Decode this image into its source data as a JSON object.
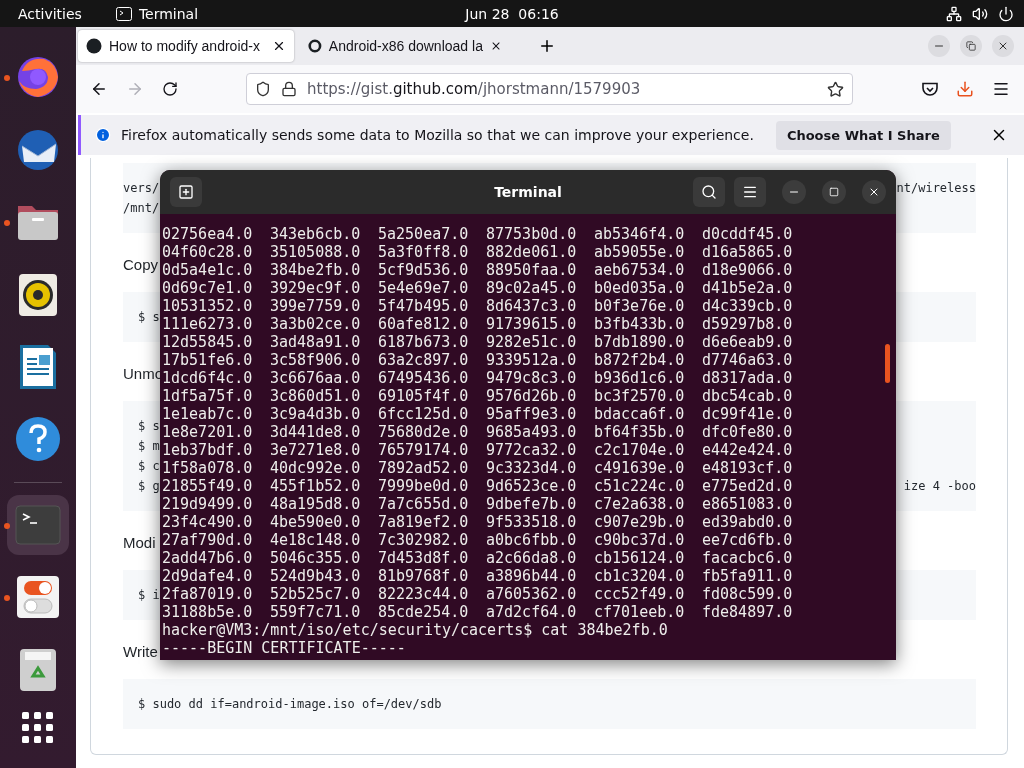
{
  "top_bar": {
    "activities": "Activities",
    "app": "Terminal",
    "clock": "Jun 28  06:16"
  },
  "dock": {
    "favorites": [
      {
        "kind": "browser",
        "running": true,
        "selected": false
      },
      {
        "kind": "mail",
        "running": false,
        "selected": false
      },
      {
        "kind": "files",
        "running": true,
        "selected": false
      },
      {
        "kind": "music",
        "running": false,
        "selected": false
      },
      {
        "kind": "document",
        "running": false,
        "selected": false
      },
      {
        "kind": "help",
        "running": false,
        "selected": false
      }
    ],
    "open": [
      {
        "kind": "terminal",
        "running": true,
        "selected": true
      },
      {
        "kind": "toggles",
        "running": true,
        "selected": false
      },
      {
        "kind": "trash",
        "running": false,
        "selected": false
      }
    ]
  },
  "browser": {
    "tabs": [
      {
        "title": "How to modify android-x",
        "selected": true
      },
      {
        "title": "Android-x86 download la",
        "selected": false
      }
    ],
    "url": {
      "prefix": "https://gist.",
      "host": "github.com",
      "path": "/jhorstmann/1579903"
    },
    "notification": {
      "message": "Firefox automatically sends some data to Mozilla so that we can improve your experience.",
      "button": "Choose What I Share"
    },
    "page": [
      {
        "kind": "code_scrolled",
        "lines": [
          {
            "left": "vers/",
            "right": "nt/wireless"
          },
          {
            "left": "/mnt/"
          }
        ]
      },
      {
        "kind": "heading",
        "text": "Copy"
      },
      {
        "kind": "code",
        "lines": [
          {
            "left": "$ s"
          }
        ]
      },
      {
        "kind": "heading",
        "text": "Unmo"
      },
      {
        "kind": "code",
        "lines": [
          {
            "left": "$ s"
          },
          {
            "left": "$ m"
          },
          {
            "left": "$ c"
          },
          {
            "left": "$ g",
            "right": "ize 4 -boo"
          }
        ]
      },
      {
        "kind": "heading",
        "text": "Modi"
      },
      {
        "kind": "code",
        "lines": [
          {
            "left": "$ i"
          }
        ]
      },
      {
        "kind": "heading",
        "text": "Write"
      },
      {
        "kind": "code",
        "lines": [
          {
            "left": "$ sudo dd if=android-image.iso of=/dev/sdb"
          }
        ]
      }
    ]
  },
  "terminal": {
    "title": "Terminal",
    "rows": [
      [
        "02756ea4.0",
        "343eb6cb.0",
        "5a250ea7.0",
        "87753b0d.0",
        "ab5346f4.0",
        "d0cddf45.0"
      ],
      [
        "04f60c28.0",
        "35105088.0",
        "5a3f0ff8.0",
        "882de061.0",
        "ab59055e.0",
        "d16a5865.0"
      ],
      [
        "0d5a4e1c.0",
        "384be2fb.0",
        "5cf9d536.0",
        "88950faa.0",
        "aeb67534.0",
        "d18e9066.0"
      ],
      [
        "0d69c7e1.0",
        "3929ec9f.0",
        "5e4e69e7.0",
        "89c02a45.0",
        "b0ed035a.0",
        "d41b5e2a.0"
      ],
      [
        "10531352.0",
        "399e7759.0",
        "5f47b495.0",
        "8d6437c3.0",
        "b0f3e76e.0",
        "d4c339cb.0"
      ],
      [
        "111e6273.0",
        "3a3b02ce.0",
        "60afe812.0",
        "91739615.0",
        "b3fb433b.0",
        "d59297b8.0"
      ],
      [
        "12d55845.0",
        "3ad48a91.0",
        "6187b673.0",
        "9282e51c.0",
        "b7db1890.0",
        "d6e6eab9.0"
      ],
      [
        "17b51fe6.0",
        "3c58f906.0",
        "63a2c897.0",
        "9339512a.0",
        "b872f2b4.0",
        "d7746a63.0"
      ],
      [
        "1dcd6f4c.0",
        "3c6676aa.0",
        "67495436.0",
        "9479c8c3.0",
        "b936d1c6.0",
        "d8317ada.0"
      ],
      [
        "1df5a75f.0",
        "3c860d51.0",
        "69105f4f.0",
        "9576d26b.0",
        "bc3f2570.0",
        "dbc54cab.0"
      ],
      [
        "1e1eab7c.0",
        "3c9a4d3b.0",
        "6fcc125d.0",
        "95aff9e3.0",
        "bdacca6f.0",
        "dc99f41e.0"
      ],
      [
        "1e8e7201.0",
        "3d441de8.0",
        "75680d2e.0",
        "9685a493.0",
        "bf64f35b.0",
        "dfc0fe80.0"
      ],
      [
        "1eb37bdf.0",
        "3e7271e8.0",
        "76579174.0",
        "9772ca32.0",
        "c2c1704e.0",
        "e442e424.0"
      ],
      [
        "1f58a078.0",
        "40dc992e.0",
        "7892ad52.0",
        "9c3323d4.0",
        "c491639e.0",
        "e48193cf.0"
      ],
      [
        "21855f49.0",
        "455f1b52.0",
        "7999be0d.0",
        "9d6523ce.0",
        "c51c224c.0",
        "e775ed2d.0"
      ],
      [
        "219d9499.0",
        "48a195d8.0",
        "7a7c655d.0",
        "9dbefe7b.0",
        "c7e2a638.0",
        "e8651083.0"
      ],
      [
        "23f4c490.0",
        "4be590e0.0",
        "7a819ef2.0",
        "9f533518.0",
        "c907e29b.0",
        "ed39abd0.0"
      ],
      [
        "27af790d.0",
        "4e18c148.0",
        "7c302982.0",
        "a0bc6fbb.0",
        "c90bc37d.0",
        "ee7cd6fb.0"
      ],
      [
        "2add47b6.0",
        "5046c355.0",
        "7d453d8f.0",
        "a2c66da8.0",
        "cb156124.0",
        "facacbc6.0"
      ],
      [
        "2d9dafe4.0",
        "524d9b43.0",
        "81b9768f.0",
        "a3896b44.0",
        "cb1c3204.0",
        "fb5fa911.0"
      ],
      [
        "2fa87019.0",
        "52b525c7.0",
        "82223c44.0",
        "a7605362.0",
        "ccc52f49.0",
        "fd08c599.0"
      ],
      [
        "31188b5e.0",
        "559f7c71.0",
        "85cde254.0",
        "a7d2cf64.0",
        "cf701eeb.0",
        "fde84897.0"
      ]
    ],
    "prompt": "hacker@VM3:/mnt/iso/etc/security/cacerts$ cat 384be2fb.0",
    "output": "-----BEGIN CERTIFICATE-----"
  }
}
